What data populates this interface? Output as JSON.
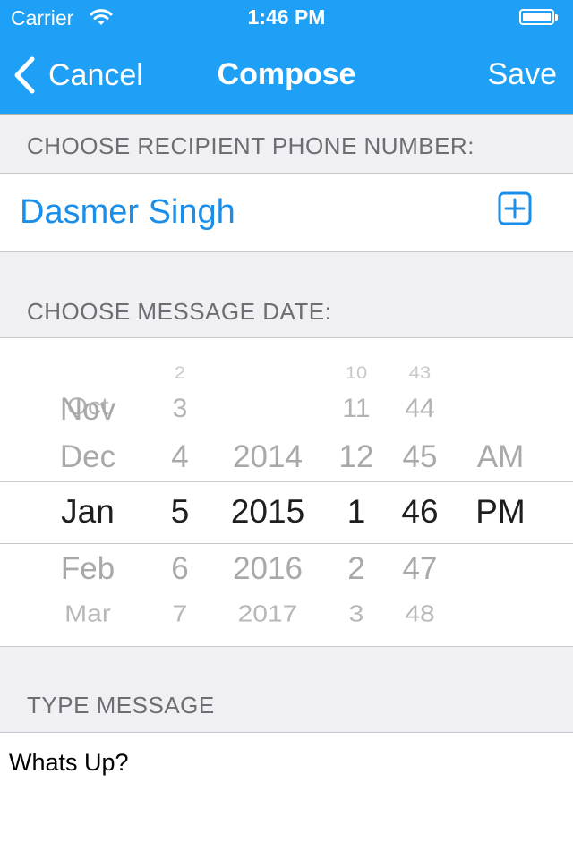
{
  "status_bar": {
    "carrier": "Carrier",
    "time": "1:46 PM",
    "wifi_icon": "wifi-icon",
    "battery_icon": "battery-icon"
  },
  "nav": {
    "back_label": "Cancel",
    "back_icon": "chevron-left-icon",
    "title": "Compose",
    "save_label": "Save"
  },
  "recipient": {
    "header": "CHOOSE RECIPIENT PHONE NUMBER:",
    "name": "Dasmer Singh",
    "add_icon": "plus-square-icon"
  },
  "date": {
    "header": "CHOOSE MESSAGE DATE:",
    "picker": {
      "month": [
        "Oct",
        "Nov",
        "Dec",
        "Jan",
        "Feb",
        "Mar"
      ],
      "day": [
        "2",
        "3",
        "4",
        "5",
        "6",
        "7"
      ],
      "year": [
        "2014",
        "2015",
        "2016",
        "2017"
      ],
      "hour": [
        "10",
        "11",
        "12",
        "1",
        "2",
        "3"
      ],
      "minute": [
        "43",
        "44",
        "45",
        "46",
        "47",
        "48"
      ],
      "ampm": [
        "AM",
        "PM"
      ]
    },
    "selected": {
      "month": "Jan",
      "day": "5",
      "year": "2015",
      "hour": "1",
      "minute": "46",
      "ampm": "PM"
    }
  },
  "message": {
    "header": "TYPE MESSAGE",
    "text": "Whats Up?"
  },
  "colors": {
    "accent": "#1fa0f7",
    "link": "#1a8ee8",
    "background": "#efeff4",
    "section_text": "#6d6d72"
  }
}
